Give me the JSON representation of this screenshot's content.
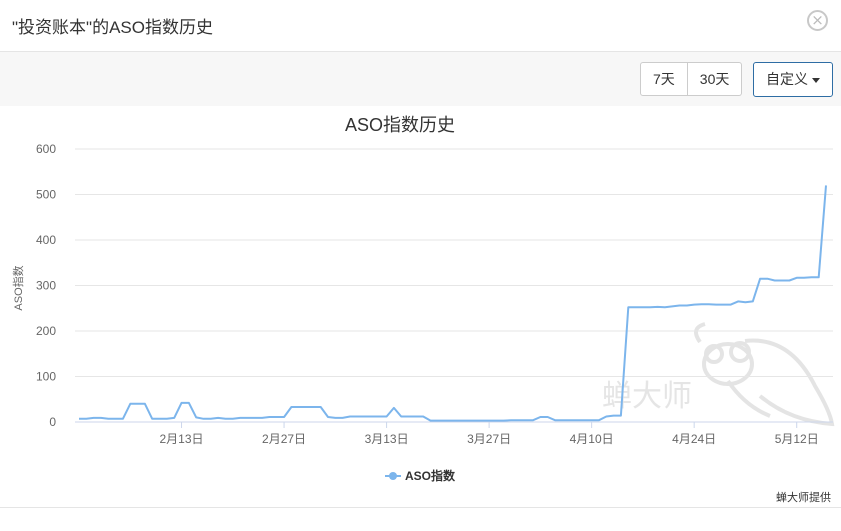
{
  "header": {
    "title": "\"投资账本\"的ASO指数历史",
    "close_glyph": "×"
  },
  "toolbar": {
    "range_buttons": [
      "7天",
      "30天"
    ],
    "custom_label": "自定义"
  },
  "watermark_text": "蝉大师",
  "credit": "蝉大师提供",
  "colors": {
    "line": "#7cb5ec",
    "grid": "#e6e6e6",
    "custom_border": "#2e6da4"
  },
  "chart_data": {
    "type": "line",
    "title": "ASO指数历史",
    "ylabel": "ASO指数",
    "xlabel": "",
    "ylim": [
      0,
      600
    ],
    "yticks": [
      0,
      100,
      200,
      300,
      400,
      500,
      600
    ],
    "xticks": [
      {
        "index": 14,
        "label": "2月13日"
      },
      {
        "index": 28,
        "label": "2月27日"
      },
      {
        "index": 42,
        "label": "3月13日"
      },
      {
        "index": 56,
        "label": "3月27日"
      },
      {
        "index": 70,
        "label": "4月10日"
      },
      {
        "index": 84,
        "label": "4月24日"
      },
      {
        "index": 98,
        "label": "5月12日"
      }
    ],
    "grid": true,
    "legend": "bottom-center",
    "series": [
      {
        "name": "ASO指数",
        "values": [
          7,
          7,
          9,
          9,
          7,
          7,
          7,
          40,
          40,
          40,
          7,
          7,
          7,
          9,
          42,
          42,
          10,
          7,
          7,
          9,
          7,
          7,
          9,
          9,
          9,
          9,
          11,
          11,
          11,
          33,
          33,
          33,
          33,
          33,
          11,
          9,
          9,
          12,
          12,
          12,
          12,
          12,
          12,
          31,
          12,
          12,
          12,
          12,
          3,
          3,
          3,
          3,
          3,
          3,
          3,
          3,
          3,
          3,
          3,
          4,
          4,
          4,
          4,
          11,
          11,
          4,
          4,
          4,
          4,
          4,
          4,
          4,
          12,
          14,
          14,
          252,
          252,
          252,
          252,
          253,
          252,
          254,
          256,
          256,
          258,
          259,
          259,
          258,
          258,
          258,
          265,
          263,
          265,
          315,
          315,
          311,
          311,
          311,
          317,
          317,
          318,
          318,
          520
        ]
      }
    ]
  }
}
